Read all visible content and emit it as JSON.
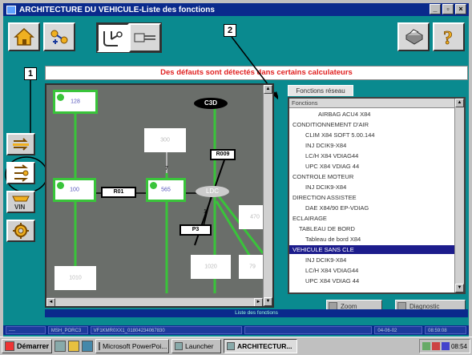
{
  "window": {
    "title": "ARCHITECTURE DU VEHICULE-Liste des fonctions",
    "controls": [
      "_",
      "▫",
      "×"
    ]
  },
  "banner": {
    "text": "Des défauts sont détectés dans certains calculateurs"
  },
  "callouts": {
    "one": "1",
    "two": "2"
  },
  "diagram": {
    "nodes": {
      "n128": "128",
      "n100": "100",
      "n565": "565",
      "n300": "300",
      "n470": "470",
      "n1010": "1010",
      "n1020": "1020",
      "n79": "79"
    },
    "tags": {
      "c3d": "C3D",
      "ldc": "LDC",
      "r009": "R009",
      "r01": "R01",
      "p3": "P3"
    }
  },
  "tree": {
    "tab": "Fonctions réseau",
    "header": "Fonctions",
    "rows": [
      {
        "text": "AIRBAG ACU4 X84",
        "indent": 4,
        "selected": false
      },
      {
        "text": "CONDITIONNEMENT D'AIR",
        "indent": 0,
        "selected": false
      },
      {
        "text": "CLIM X84 SOFT 5.00.144",
        "indent": 2,
        "selected": false
      },
      {
        "text": "INJ DCIK9-X84",
        "indent": 2,
        "selected": false
      },
      {
        "text": "LC/H X84 VDIAG44",
        "indent": 2,
        "selected": false
      },
      {
        "text": "UPC X84 VDIAG 44",
        "indent": 2,
        "selected": false
      },
      {
        "text": "CONTROLE MOTEUR",
        "indent": 0,
        "selected": false
      },
      {
        "text": "INJ DCIK9-X84",
        "indent": 2,
        "selected": false
      },
      {
        "text": "DIRECTION ASSISTEE",
        "indent": 0,
        "selected": false
      },
      {
        "text": "DAE X84/90 EP-VDIAG",
        "indent": 2,
        "selected": false
      },
      {
        "text": "ECLAIRAGE",
        "indent": 0,
        "selected": false
      },
      {
        "text": "TABLEAU DE BORD",
        "indent": 1,
        "selected": false
      },
      {
        "text": "Tableau de bord X84",
        "indent": 2,
        "selected": false
      },
      {
        "text": "VEHICULE SANS CLE",
        "indent": 0,
        "selected": true
      },
      {
        "text": "INJ DCIK9-X84",
        "indent": 2,
        "selected": false
      },
      {
        "text": "LC/H X84 VDIAG44",
        "indent": 2,
        "selected": false
      },
      {
        "text": "UPC X84 VDIAG 44",
        "indent": 2,
        "selected": false
      }
    ],
    "buttons": {
      "zoom": "Zoom",
      "diagnostic": "Diagnostic"
    }
  },
  "statusline": {
    "text": "Liste des fonctions"
  },
  "statusbar": {
    "cells": [
      "----",
      "MSH_PORC3",
      "VF1KMR0XX1_01804234067830",
      "",
      "04-06-02",
      "08:59:08"
    ]
  },
  "taskbar": {
    "start": "Démarrer",
    "tasks": [
      {
        "label": "Microsoft PowerPoi...",
        "active": false
      },
      {
        "label": "Launcher",
        "active": false
      },
      {
        "label": "ARCHITECTUR...",
        "active": true
      }
    ],
    "clock": "08:54"
  },
  "colors": {
    "app_bg": "#0a8a8f",
    "title_bg": "#0a2a8c",
    "node_ok": "#39c43a",
    "alert_text": "#e02020",
    "selection": "#1c1c8c"
  }
}
